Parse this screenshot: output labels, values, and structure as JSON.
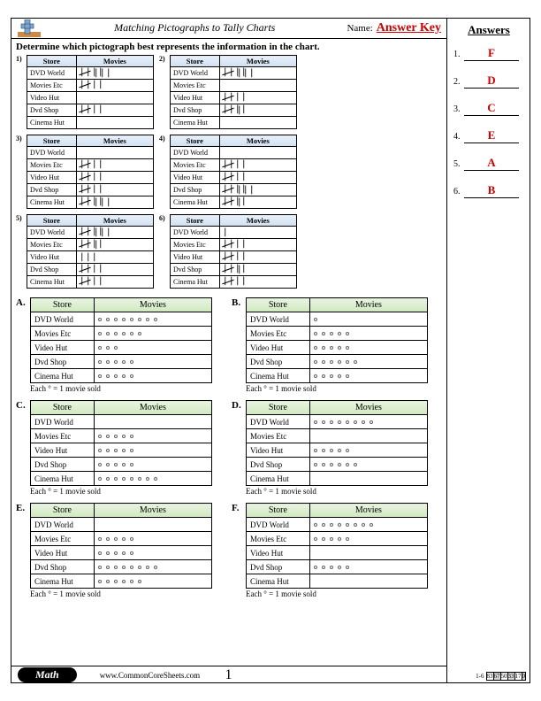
{
  "header": {
    "title": "Matching Pictographs to Tally Charts",
    "name_label": "Name:",
    "answer_key": "Answer Key"
  },
  "instruction": "Determine which pictograph best represents the information in the chart.",
  "stores": [
    "DVD World",
    "Movies Etc",
    "Video Hut",
    "Dvd Shop",
    "Cinema Hut"
  ],
  "tally_columns": {
    "store": "Store",
    "movies": "Movies"
  },
  "tally_charts": [
    {
      "num": "1)",
      "values": [
        8,
        5,
        0,
        5,
        0
      ]
    },
    {
      "num": "2)",
      "values": [
        8,
        0,
        5,
        6,
        0
      ]
    },
    {
      "num": "3)",
      "values": [
        0,
        5,
        5,
        5,
        8
      ]
    },
    {
      "num": "4)",
      "values": [
        0,
        5,
        5,
        8,
        6
      ]
    },
    {
      "num": "5)",
      "values": [
        8,
        6,
        3,
        5,
        5
      ]
    },
    {
      "num": "6)",
      "values": [
        1,
        5,
        5,
        6,
        5
      ]
    }
  ],
  "picto_columns": {
    "store": "Store",
    "movies": "Movies"
  },
  "pictographs": [
    {
      "label": "A.",
      "values": [
        8,
        6,
        3,
        5,
        5
      ]
    },
    {
      "label": "B.",
      "values": [
        1,
        5,
        5,
        6,
        5
      ]
    },
    {
      "label": "C.",
      "values": [
        0,
        5,
        5,
        5,
        8
      ]
    },
    {
      "label": "D.",
      "values": [
        8,
        0,
        5,
        6,
        0
      ]
    },
    {
      "label": "E.",
      "values": [
        0,
        5,
        5,
        8,
        6
      ]
    },
    {
      "label": "F.",
      "values": [
        8,
        5,
        0,
        5,
        0
      ]
    }
  ],
  "legend_text": "Each  °  = 1 movie sold",
  "answers": {
    "title": "Answers",
    "items": [
      {
        "num": "1.",
        "val": "F"
      },
      {
        "num": "2.",
        "val": "D"
      },
      {
        "num": "3.",
        "val": "C"
      },
      {
        "num": "4.",
        "val": "E"
      },
      {
        "num": "5.",
        "val": "A"
      },
      {
        "num": "6.",
        "val": "B"
      }
    ]
  },
  "footer": {
    "subject": "Math",
    "website": "www.CommonCoreSheets.com",
    "page": "1",
    "score_label": "1-6",
    "scores": [
      "83",
      "67",
      "50",
      "33",
      "17",
      "0"
    ]
  },
  "chart_data": {
    "type": "table",
    "description": "Six tally charts and six pictographs showing number of movies sold by store. Task: match each tally chart (1-6) to a pictograph (A-F).",
    "stores": [
      "DVD World",
      "Movies Etc",
      "Video Hut",
      "Dvd Shop",
      "Cinema Hut"
    ],
    "tally_charts": {
      "1": [
        8,
        5,
        0,
        5,
        0
      ],
      "2": [
        8,
        0,
        5,
        6,
        0
      ],
      "3": [
        0,
        5,
        5,
        5,
        8
      ],
      "4": [
        0,
        5,
        5,
        8,
        6
      ],
      "5": [
        8,
        6,
        3,
        5,
        5
      ],
      "6": [
        1,
        5,
        5,
        6,
        5
      ]
    },
    "pictographs": {
      "A": [
        8,
        6,
        3,
        5,
        5
      ],
      "B": [
        1,
        5,
        5,
        6,
        5
      ],
      "C": [
        0,
        5,
        5,
        5,
        8
      ],
      "D": [
        8,
        0,
        5,
        6,
        0
      ],
      "E": [
        0,
        5,
        5,
        8,
        6
      ],
      "F": [
        8,
        5,
        0,
        5,
        0
      ]
    },
    "pictograph_key": "each symbol = 1 movie sold",
    "answers": {
      "1": "F",
      "2": "D",
      "3": "C",
      "4": "E",
      "5": "A",
      "6": "B"
    }
  }
}
